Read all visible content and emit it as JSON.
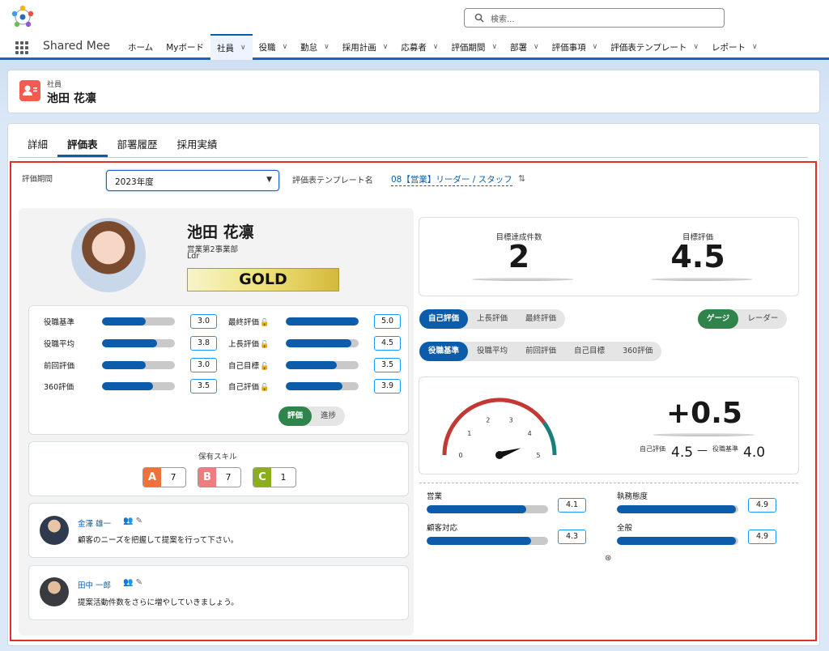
{
  "app": {
    "name": "Shared Mee"
  },
  "search": {
    "placeholder": "検索..."
  },
  "nav": {
    "items": [
      {
        "label": "ホーム",
        "chevron": false
      },
      {
        "label": "Myボード",
        "chevron": false
      },
      {
        "label": "社員",
        "chevron": true,
        "active": true
      },
      {
        "label": "役職",
        "chevron": true
      },
      {
        "label": "勤怠",
        "chevron": true
      },
      {
        "label": "採用計画",
        "chevron": true
      },
      {
        "label": "応募者",
        "chevron": true
      },
      {
        "label": "評価期間",
        "chevron": true
      },
      {
        "label": "部署",
        "chevron": true
      },
      {
        "label": "評価事項",
        "chevron": true
      },
      {
        "label": "評価表テンプレート",
        "chevron": true
      },
      {
        "label": "レポート",
        "chevron": true
      }
    ]
  },
  "record": {
    "type": "社員",
    "name": "池田 花凛"
  },
  "tabs": [
    "詳細",
    "評価表",
    "部署履歴",
    "採用実績"
  ],
  "filters": {
    "period_label": "評価期間",
    "period_value": "2023年度",
    "template_label": "評価表テンプレート名",
    "template_value": "08【営業】リーダー / スタッフ"
  },
  "profile": {
    "name": "池田 花凛",
    "department": "営業第2事業部",
    "role": "Ldr",
    "rank": "GOLD"
  },
  "metrics_left": [
    {
      "label": "役職基準",
      "value": "3.0",
      "level": 0.6
    },
    {
      "label": "役職平均",
      "value": "3.8",
      "level": 0.76
    },
    {
      "label": "前回評価",
      "value": "3.0",
      "level": 0.6
    },
    {
      "label": "360評価",
      "value": "3.5",
      "level": 0.7
    }
  ],
  "metrics_right": [
    {
      "label": "最終評価",
      "value": "5.0",
      "level": 1.0
    },
    {
      "label": "上長評価",
      "value": "4.5",
      "level": 0.9
    },
    {
      "label": "自己目標",
      "value": "3.5",
      "level": 0.7
    },
    {
      "label": "自己評価",
      "value": "3.9",
      "level": 0.78
    }
  ],
  "toggle_eval": {
    "on": "評価",
    "off": "進捗"
  },
  "skills": {
    "title": "保有スキル",
    "items": [
      {
        "letter": "A",
        "count": "7",
        "color": "#f0713a"
      },
      {
        "letter": "B",
        "count": "7",
        "color": "#ee7d80"
      },
      {
        "letter": "C",
        "count": "1",
        "color": "#8cae1e"
      }
    ]
  },
  "comments": [
    {
      "author": "金澤 雄一",
      "text": "顧客のニーズを把握して提案を行って下さい。"
    },
    {
      "author": "田中 一郎",
      "text": "提案活動件数をさらに増やしていきましょう。"
    }
  ],
  "stats": {
    "goal_count_label": "目標達成件数",
    "goal_count_value": "2",
    "goal_eval_label": "目標評価",
    "goal_eval_value": "4.5"
  },
  "eval_tabs": {
    "items": [
      "自己評価",
      "上長評価",
      "最終評価"
    ],
    "selected": 0
  },
  "view_toggle": {
    "items": [
      "ゲージ",
      "レーダー"
    ],
    "selected": 0
  },
  "compare_tabs": {
    "items": [
      "役職基準",
      "役職平均",
      "前回評価",
      "自己目標",
      "360評価"
    ],
    "selected": 0
  },
  "gauge": {
    "ticks": [
      "0",
      "1",
      "2",
      "3",
      "4",
      "5"
    ],
    "value": 4.5,
    "delta": "+0.5",
    "self_label": "自己評価",
    "self_value": "4.5",
    "dash": "—",
    "base_label": "役職基準",
    "base_value": "4.0",
    "colors": {
      "low": "#c23934",
      "high": "#1b7f79"
    }
  },
  "categories": [
    {
      "label": "営業",
      "value": "4.1",
      "level": 0.82
    },
    {
      "label": "執務態度",
      "value": "4.9",
      "level": 0.98
    },
    {
      "label": "顧客対応",
      "value": "4.3",
      "level": 0.86
    },
    {
      "label": "全般",
      "value": "4.9",
      "level": 0.98
    }
  ]
}
